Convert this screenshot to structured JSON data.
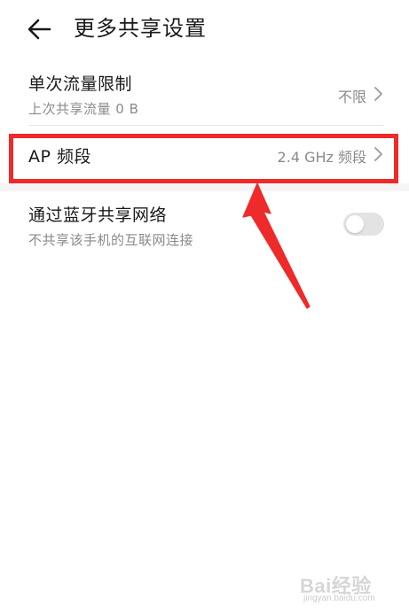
{
  "header": {
    "back_icon": "arrow-left-icon",
    "title": "更多共享设置"
  },
  "settings": {
    "traffic_limit": {
      "title": "单次流量限制",
      "subtitle": "上次共享流量 0 B",
      "value": "不限",
      "icon": "chevron-right-icon"
    },
    "ap_band": {
      "title": "AP 频段",
      "value": "2.4 GHz 频段",
      "icon": "chevron-right-icon"
    },
    "bluetooth_share": {
      "title": "通过蓝牙共享网络",
      "subtitle": "不共享该手机的互联网连接",
      "toggle_on": false
    }
  },
  "annotation": {
    "highlight_color": "#ee2a2a",
    "arrow_color": "#ee2a2a"
  },
  "watermark": {
    "main": "Bai经验",
    "sub": "jingyan.baidu.com"
  },
  "colors": {
    "primary_text": "#1a1a1a",
    "secondary_text": "#8a8a8a",
    "toggle_off": "#e3e3e3"
  }
}
